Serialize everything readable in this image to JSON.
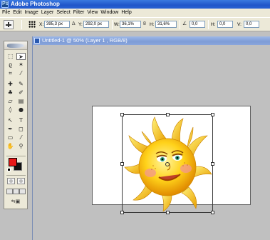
{
  "app": {
    "title": "Adobe Photoshop",
    "icon": "photoshop-app-icon",
    "icon_glyph": "Ps"
  },
  "menu": [
    "File",
    "Edit",
    "Image",
    "Layer",
    "Select",
    "Filter",
    "View",
    "Window",
    "Help"
  ],
  "options": {
    "x_label": "X:",
    "x_value": "395,3 px",
    "delta": "Δ",
    "y_label": "Y:",
    "y_value": "292,0 px",
    "w_label": "W:",
    "w_value": "36,1%",
    "link": "8",
    "h_label": "H:",
    "h_value": "31,6%",
    "angle_glyph": "∠",
    "angle_value": "0,0",
    "hskew_label": "H:",
    "hskew_value": "0,0",
    "vskew_label": "V:",
    "vskew_value": "0,0"
  },
  "document": {
    "title": "Untitled-1 @ 50% (Layer 1 , RGB/8)"
  },
  "toolbox": {
    "tools": [
      {
        "name": "marquee-tool",
        "glyph": "⬚",
        "active": false
      },
      {
        "name": "move-tool",
        "glyph": "➤",
        "active": true
      },
      {
        "name": "lasso-tool",
        "glyph": "ϱ",
        "active": false
      },
      {
        "name": "magic-wand-tool",
        "glyph": "✶",
        "active": false
      },
      {
        "name": "crop-tool",
        "glyph": "⌗",
        "active": false
      },
      {
        "name": "slice-tool",
        "glyph": "⁄",
        "active": false
      },
      {
        "name": "healing-brush-tool",
        "glyph": "✚",
        "active": false
      },
      {
        "name": "brush-tool",
        "glyph": "✎",
        "active": false
      },
      {
        "name": "clone-stamp-tool",
        "glyph": "♣",
        "active": false
      },
      {
        "name": "history-brush-tool",
        "glyph": "✐",
        "active": false
      },
      {
        "name": "eraser-tool",
        "glyph": "▱",
        "active": false
      },
      {
        "name": "gradient-tool",
        "glyph": "▤",
        "active": false
      },
      {
        "name": "blur-tool",
        "glyph": "◊",
        "active": false
      },
      {
        "name": "dodge-tool",
        "glyph": "●",
        "active": false
      },
      {
        "name": "path-selection-tool",
        "glyph": "↖",
        "active": false
      },
      {
        "name": "type-tool",
        "glyph": "T",
        "active": false
      },
      {
        "name": "pen-tool",
        "glyph": "✒",
        "active": false
      },
      {
        "name": "shape-tool",
        "glyph": "◻",
        "active": false
      },
      {
        "name": "notes-tool",
        "glyph": "▭",
        "active": false
      },
      {
        "name": "eyedropper-tool",
        "glyph": "⁄",
        "active": false
      },
      {
        "name": "hand-tool",
        "glyph": "✋",
        "active": false
      },
      {
        "name": "zoom-tool",
        "glyph": "⚲",
        "active": false
      }
    ],
    "colors": {
      "foreground": "#e81818",
      "background": "#111111"
    }
  }
}
